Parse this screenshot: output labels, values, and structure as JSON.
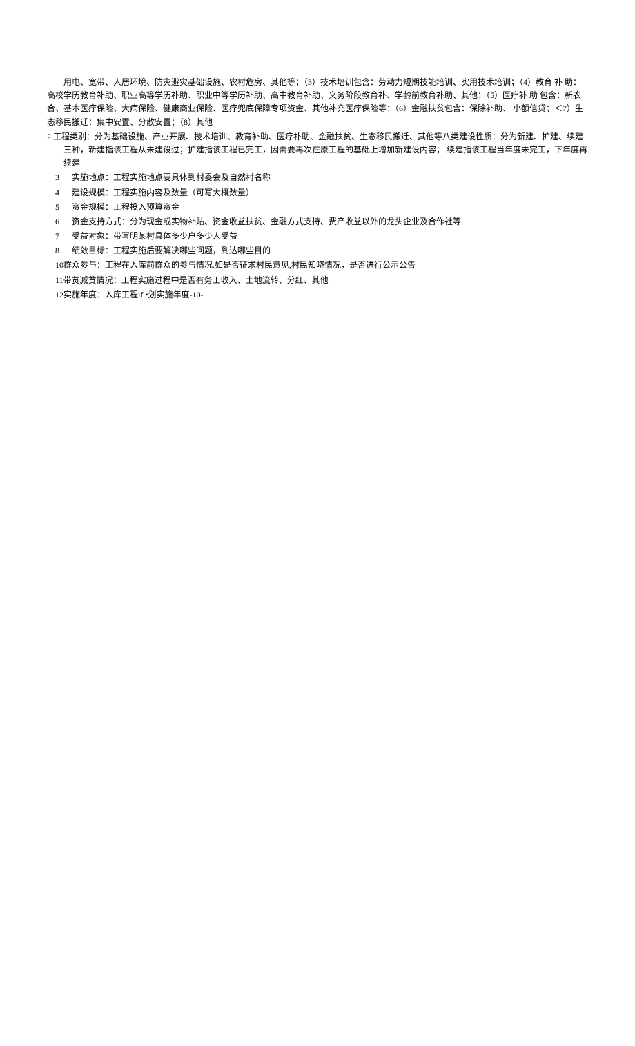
{
  "continuation_lines": [
    "用电、宽带、人居环境、防灾避灾基础设施、农村危房、其他等；（3）技术培训包含：劳动力短期技能培训、实用技术培训；（4）教育 补 助：高校学历教育补助、职业高等学历补助、职业中等学历补助、高中教育补助、义务阶段教育补、学龄前教育补助、其他；（5）医疗补 助 包含：新农合、基本医疗保险、大病保险、健康商业保险、医疗兜底保障专项资金、其他补充医疗保险等；（6）金融扶贫包含：保除补助、 小额信贷；＜7）生态移民搬迁：集中安置、分散安置；（8）其他"
  ],
  "item2": {
    "num": "2",
    "text": "工程类别：分为基础设施、产业开展、技术培训、教育补助、医疗补助、金融扶贫、生态移民搬迁、其他等八类建设性质：分为新建、扩建、续建三种，新建指该工程从未建设过；扩建指该工程已完工，因需要再次在原工程的基础上增加新建设内容； 续建指该工程当年度未完工，下年度再续建"
  },
  "items": [
    {
      "num": "3",
      "text": "实施地点：工程实施地点要具体到村委会及自然村名称"
    },
    {
      "num": "4",
      "text": "建设规模：工程实施内容及数量（可写大概数量）"
    },
    {
      "num": "5",
      "text": "资金规模：工程投入预算资金"
    },
    {
      "num": "6",
      "text": "资金支持方式：分为现金或实物补贴、资金收益扶贫、金融方式支持、费产收益以外的龙头企业及合作社等"
    },
    {
      "num": "7",
      "text": "受益对象：带写明某村具体多少户多少人受益"
    },
    {
      "num": "8",
      "text": "绩效目标：工程实施后要解决哪些问题，到达哪些目的"
    }
  ],
  "items_flush": [
    {
      "num": "10",
      "text": "群众参与：工程在入库前群众的参与情况.如是否征求村民意见,村民知晓情况，是否进行公示公告"
    },
    {
      "num": "11",
      "text": "带贫减贫情况：工程实施过程中是否有务工收入、土地流转、分红、其他"
    },
    {
      "num": "12",
      "text": "实施年度：入库工程if •划实施年度-10-"
    }
  ]
}
